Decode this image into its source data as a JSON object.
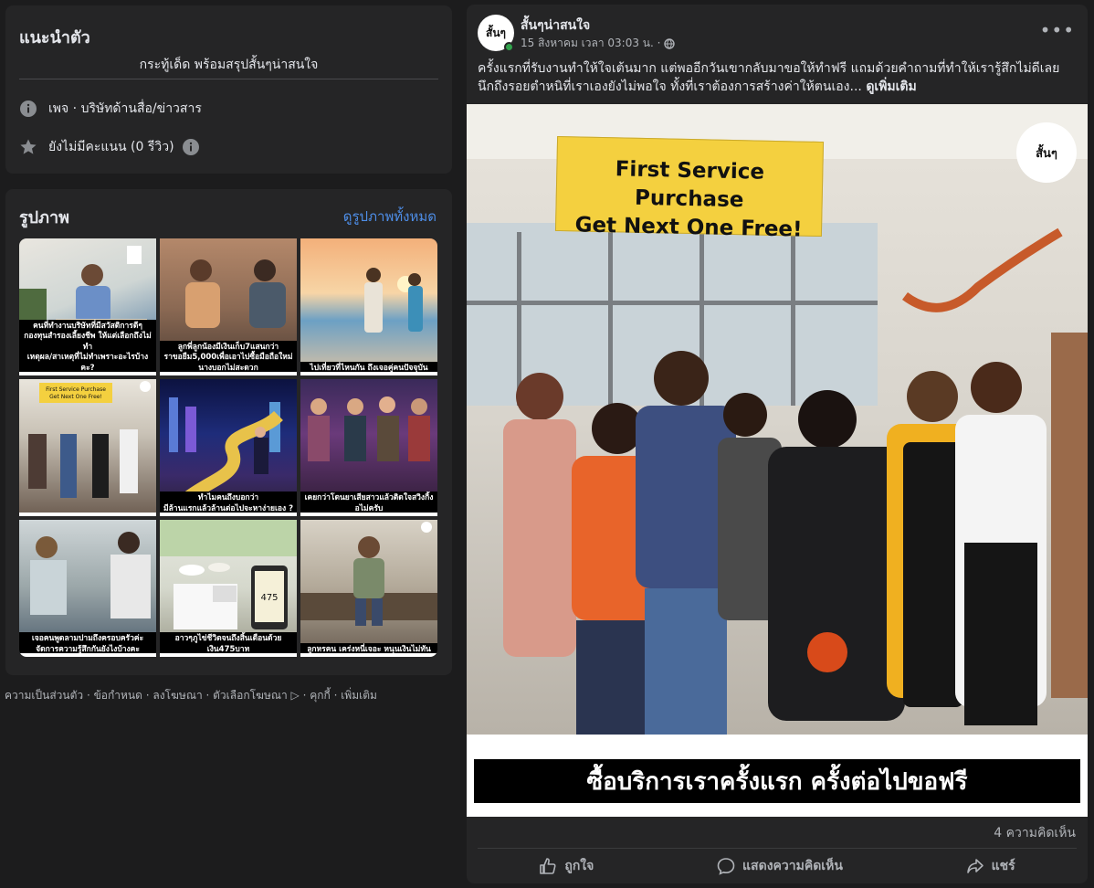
{
  "intro": {
    "title": "แนะนำตัว",
    "tagline": "กระทู้เด็ด พร้อมสรุปสั้นๆน่าสนใจ",
    "category": "เพจ · บริษัทด้านสื่อ/ข่าวสาร",
    "rating": "ยังไม่มีคะแนน (0 รีวิว)"
  },
  "photos": {
    "title": "รูปภาพ",
    "see_all": "ดูรูปภาพทั้งหมด",
    "items": [
      {
        "caption": "คนที่ทำงานบริษัทที่มีสวัสดิการดีๆ\nกองทุนสำรองเลี้ยงชีพ ให้แต่เลือกถึงไม่ทำ\nเหตุผล/สาเหตุที่ไม่ทำเพราะอะไรบ้างคะ?"
      },
      {
        "caption": "ลูกพี่ลูกน้องมีเงินเก็บ7แสนกว่า\nราขอยืม5,000เพื่อเอาไปซื้อมือถือใหม่\nนางบอกไม่สะดวก"
      },
      {
        "caption": "ไปเที่ยวที่ไหนกัน ถึงเจอคู่คนปัจจุบัน"
      },
      {
        "caption": ""
      },
      {
        "caption": "ทำไมคนถึงบอกว่า\nมีล้านแรกแล้วล้านต่อไปจะหาง่ายเอง ?"
      },
      {
        "caption": "เคยกว่าโดนยาเสียสาวแล้วติดใจสวิงกิ้ง\nอไม่ครับ"
      },
      {
        "caption": "เจอคนพูดลามปามถึงครอบครัวค่ะ\nจัดการความรู้สึกกันยังไงบ้างคะ"
      },
      {
        "caption": "อาวๆภูไข่ชีวิตจนถึงสิ้นเดือนด้วยเงิน475บาท"
      },
      {
        "caption": "ลูกหรคน เคร่งหนี่เจอะ หนุนเงินไม่ทัน"
      }
    ]
  },
  "footer": {
    "links": "ความเป็นส่วนตัว · ข้อกำหนด · ลงโฆษณา · ตัวเลือกโฆษณา ▷ · คุกกี้ · เพิ่มเติม"
  },
  "post": {
    "page_name": "สั้นๆน่าสนใจ",
    "avatar_text": "สั้นๆ",
    "timestamp": "15 สิงหาคม เวลา 03:03 น. ·",
    "text_line1": "ครั้งแรกที่รับงานทำให้ใจเต้นมาก แต่พออีกวันเขากลับมาขอให้ทำฟรี แถมด้วยคำถามที่ทำให้เรารู้สึกไม่ดีเลย",
    "text_line2": "นึกถึงรอยตำหนิที่เราเองยังไม่พอใจ ทั้งที่เราต้องการสร้างค่าให้ตนเอง...",
    "see_more": "ดูเพิ่มเติม",
    "image_sign_line1": "First Service Purchase",
    "image_sign_line2": "Get Next One Free!",
    "image_logo": "สั้นๆ",
    "image_banner": "ซื้อบริการเราครั้งแรก ครั้งต่อไปขอฟรี",
    "comments_count": "4 ความคิดเห็น",
    "actions": {
      "like": "ถูกใจ",
      "comment": "แสดงความคิดเห็น",
      "share": "แชร์"
    }
  },
  "colors": {
    "background": "#1c1c1d",
    "card": "#252526",
    "link": "#4e8ee8",
    "online": "#31a24c",
    "sign": "#f4d03f"
  }
}
